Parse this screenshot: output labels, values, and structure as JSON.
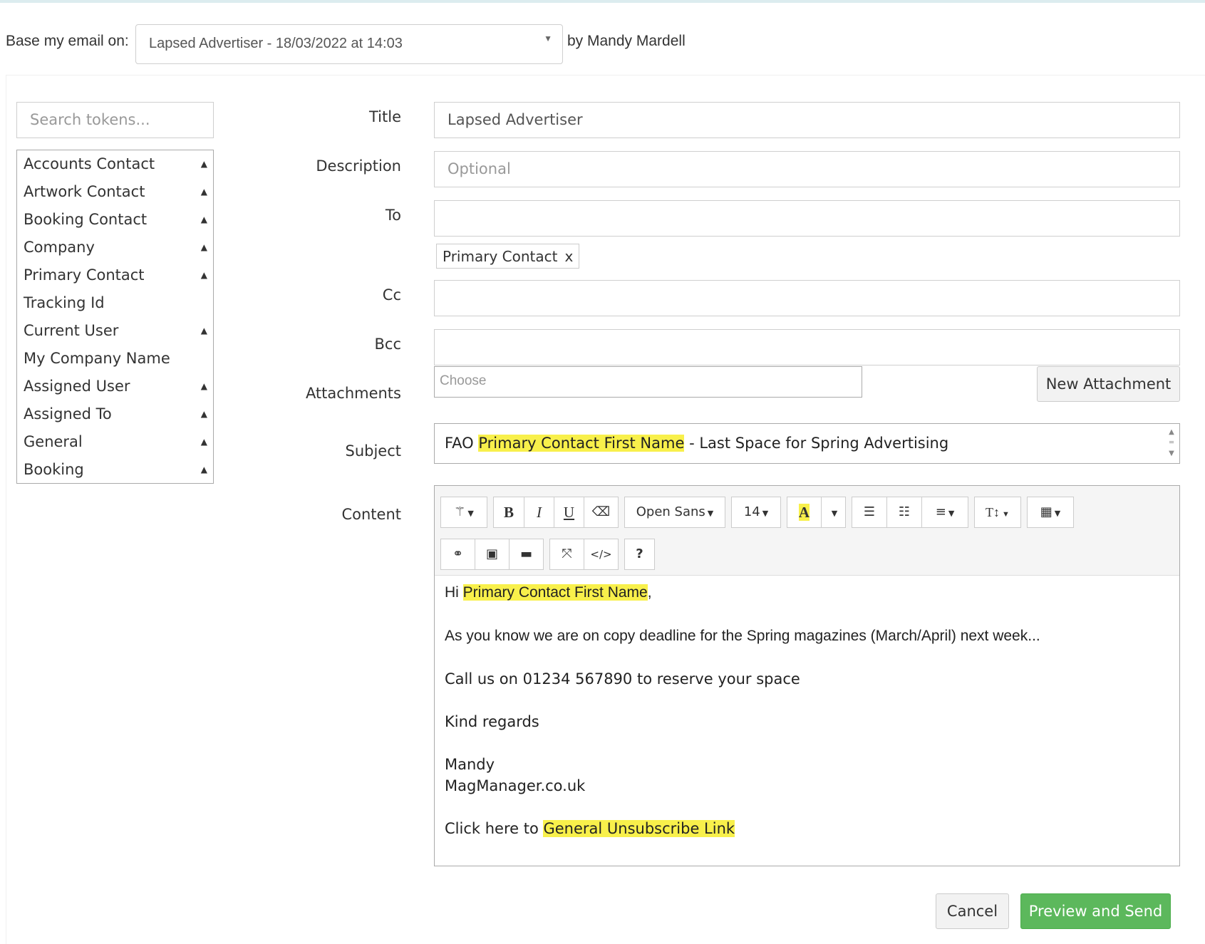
{
  "header": {
    "base_label": "Base my email on:",
    "base_selected": "Lapsed Advertiser - 18/03/2022 at 14:03",
    "by_user": "by Mandy Mardell"
  },
  "tokens": {
    "search_placeholder": "Search tokens...",
    "items": [
      {
        "label": "Accounts Contact",
        "expandable": true
      },
      {
        "label": "Artwork Contact",
        "expandable": true
      },
      {
        "label": "Booking Contact",
        "expandable": true
      },
      {
        "label": "Company",
        "expandable": true
      },
      {
        "label": "Primary Contact",
        "expandable": true
      },
      {
        "label": "Tracking Id",
        "expandable": false
      },
      {
        "label": "Current User",
        "expandable": true
      },
      {
        "label": "My Company Name",
        "expandable": false
      },
      {
        "label": "Assigned User",
        "expandable": true
      },
      {
        "label": "Assigned To",
        "expandable": true
      },
      {
        "label": "General",
        "expandable": true
      },
      {
        "label": "Booking",
        "expandable": true
      }
    ]
  },
  "form": {
    "labels": {
      "title": "Title",
      "description": "Description",
      "to": "To",
      "cc": "Cc",
      "bcc": "Bcc",
      "attachments": "Attachments",
      "subject": "Subject",
      "content": "Content"
    },
    "title_value": "Lapsed Advertiser",
    "description_placeholder": "Optional",
    "to_value": "",
    "to_chip": "Primary Contact",
    "to_chip_remove": "x",
    "cc_value": "",
    "bcc_value": "",
    "attachment_placeholder": "Choose",
    "new_attachment_label": "New Attachment",
    "subject": {
      "prefix": "FAO ",
      "token": "Primary Contact First Name",
      "suffix": " - Last Space for Spring Advertising"
    }
  },
  "editor": {
    "toolbar": {
      "font_name": "Open Sans",
      "font_size": "14",
      "color_glyph": "A",
      "help_glyph": "?"
    },
    "content": {
      "greeting_prefix": "Hi ",
      "greeting_token": "Primary Contact First Name",
      "greeting_suffix": ",",
      "line1": "As you know we are on copy deadline for the Spring magazines (March/April) next week...",
      "line2": "Call us on 01234 567890 to reserve your space",
      "line3": "Kind regards",
      "sig_name": "Mandy",
      "sig_company": "MagManager.co.uk",
      "unsub_prefix": "Click here to ",
      "unsub_token": "General Unsubscribe Link"
    }
  },
  "actions": {
    "cancel_label": "Cancel",
    "send_label": "Preview and Send"
  },
  "colors": {
    "highlight": "#f8f04b",
    "send_button": "#5cb85c"
  }
}
